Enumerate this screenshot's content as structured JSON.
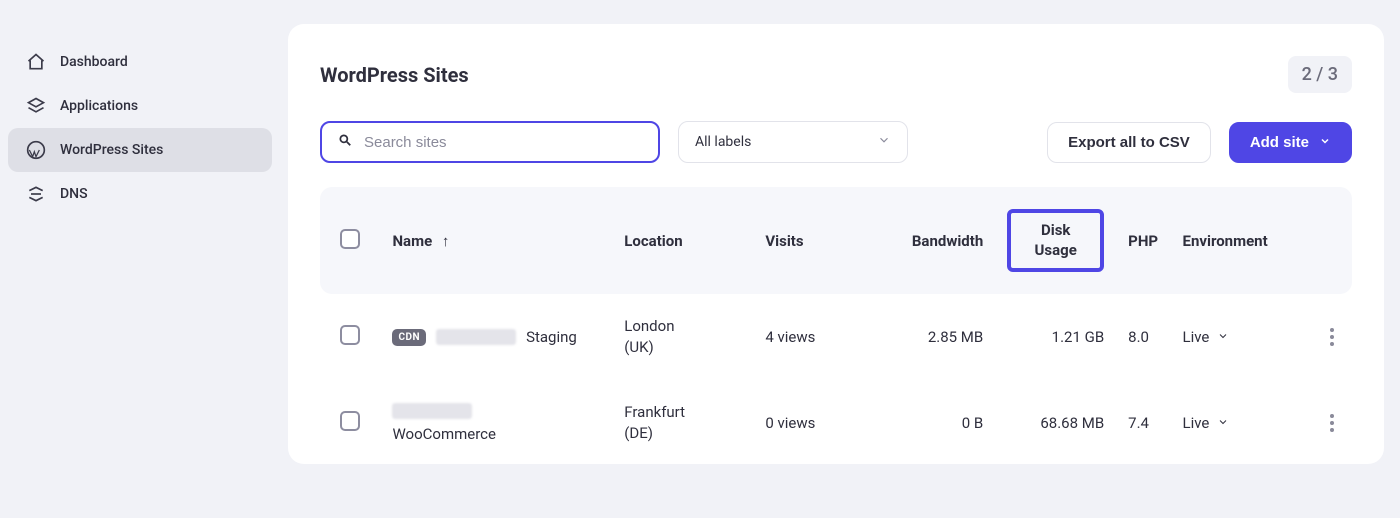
{
  "sidebar": {
    "items": [
      {
        "label": "Dashboard"
      },
      {
        "label": "Applications"
      },
      {
        "label": "WordPress Sites"
      },
      {
        "label": "DNS"
      }
    ]
  },
  "header": {
    "title": "WordPress Sites",
    "pager": "2 / 3"
  },
  "filters": {
    "search_placeholder": "Search sites",
    "labels_select": "All labels",
    "export_btn": "Export all to CSV",
    "add_btn": "Add site"
  },
  "table": {
    "columns": {
      "name": "Name",
      "location": "Location",
      "visits": "Visits",
      "bandwidth": "Bandwidth",
      "disk": "Disk Usage",
      "php": "PHP",
      "environment": "Environment"
    },
    "rows": [
      {
        "cdn": "CDN",
        "name_suffix": "Staging",
        "name_extra": "",
        "location_city": "London",
        "location_cc": "(UK)",
        "visits": "4 views",
        "bandwidth": "2.85 MB",
        "disk": "1.21 GB",
        "php": "8.0",
        "environment": "Live"
      },
      {
        "cdn": "",
        "name_suffix": "",
        "name_extra": "WooCommerce",
        "location_city": "Frankfurt",
        "location_cc": "(DE)",
        "visits": "0 views",
        "bandwidth": "0 B",
        "disk": "68.68 MB",
        "php": "7.4",
        "environment": "Live"
      }
    ]
  }
}
